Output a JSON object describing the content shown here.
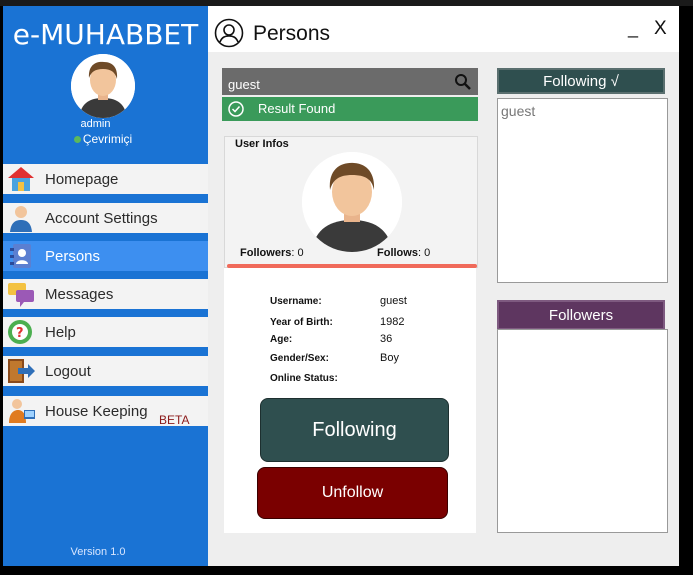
{
  "window": {
    "app_title": "e-MUHABBET",
    "header_title": "Persons",
    "minimize_label": "_",
    "close_label": "X"
  },
  "sidebar": {
    "username": "admin",
    "status": "Çevrimiçi",
    "items": [
      {
        "label": "Homepage",
        "icon": "home-icon"
      },
      {
        "label": "Account Settings",
        "icon": "account-settings-icon"
      },
      {
        "label": "Persons",
        "icon": "persons-icon"
      },
      {
        "label": "Messages",
        "icon": "messages-icon"
      },
      {
        "label": "Help",
        "icon": "help-icon"
      },
      {
        "label": "Logout",
        "icon": "logout-icon"
      },
      {
        "label": "House Keeping",
        "icon": "house-keeping-icon"
      }
    ],
    "beta_label": "BETA",
    "version": "Version 1.0"
  },
  "search": {
    "value": "guest",
    "result_text": "Result Found"
  },
  "user_infos": {
    "title": "User Infos",
    "followers_label": "Followers",
    "followers_count": ": 0",
    "follows_label": "Follows",
    "follows_count": ": 0",
    "fields": [
      {
        "label": "Username:",
        "value": "guest"
      },
      {
        "label": "Year of Birth:",
        "value": "1982"
      },
      {
        "label": "Age:",
        "value": "36"
      },
      {
        "label": "Gender/Sex:",
        "value": "Boy"
      },
      {
        "label": "Online Status:",
        "value": ""
      }
    ],
    "following_button": "Following",
    "unfollow_button": "Unfollow"
  },
  "following_panel": {
    "title": "Following √",
    "items": [
      "guest"
    ]
  },
  "followers_panel": {
    "title": "Followers",
    "items": []
  },
  "colors": {
    "sidebar_blue": "#1a73d4",
    "active_item": "#3d8ff0",
    "result_green": "#3a9a5a",
    "following_dark": "#2f4f4f",
    "unfollow_red": "#7a0000",
    "followers_purple": "#5e3660"
  }
}
